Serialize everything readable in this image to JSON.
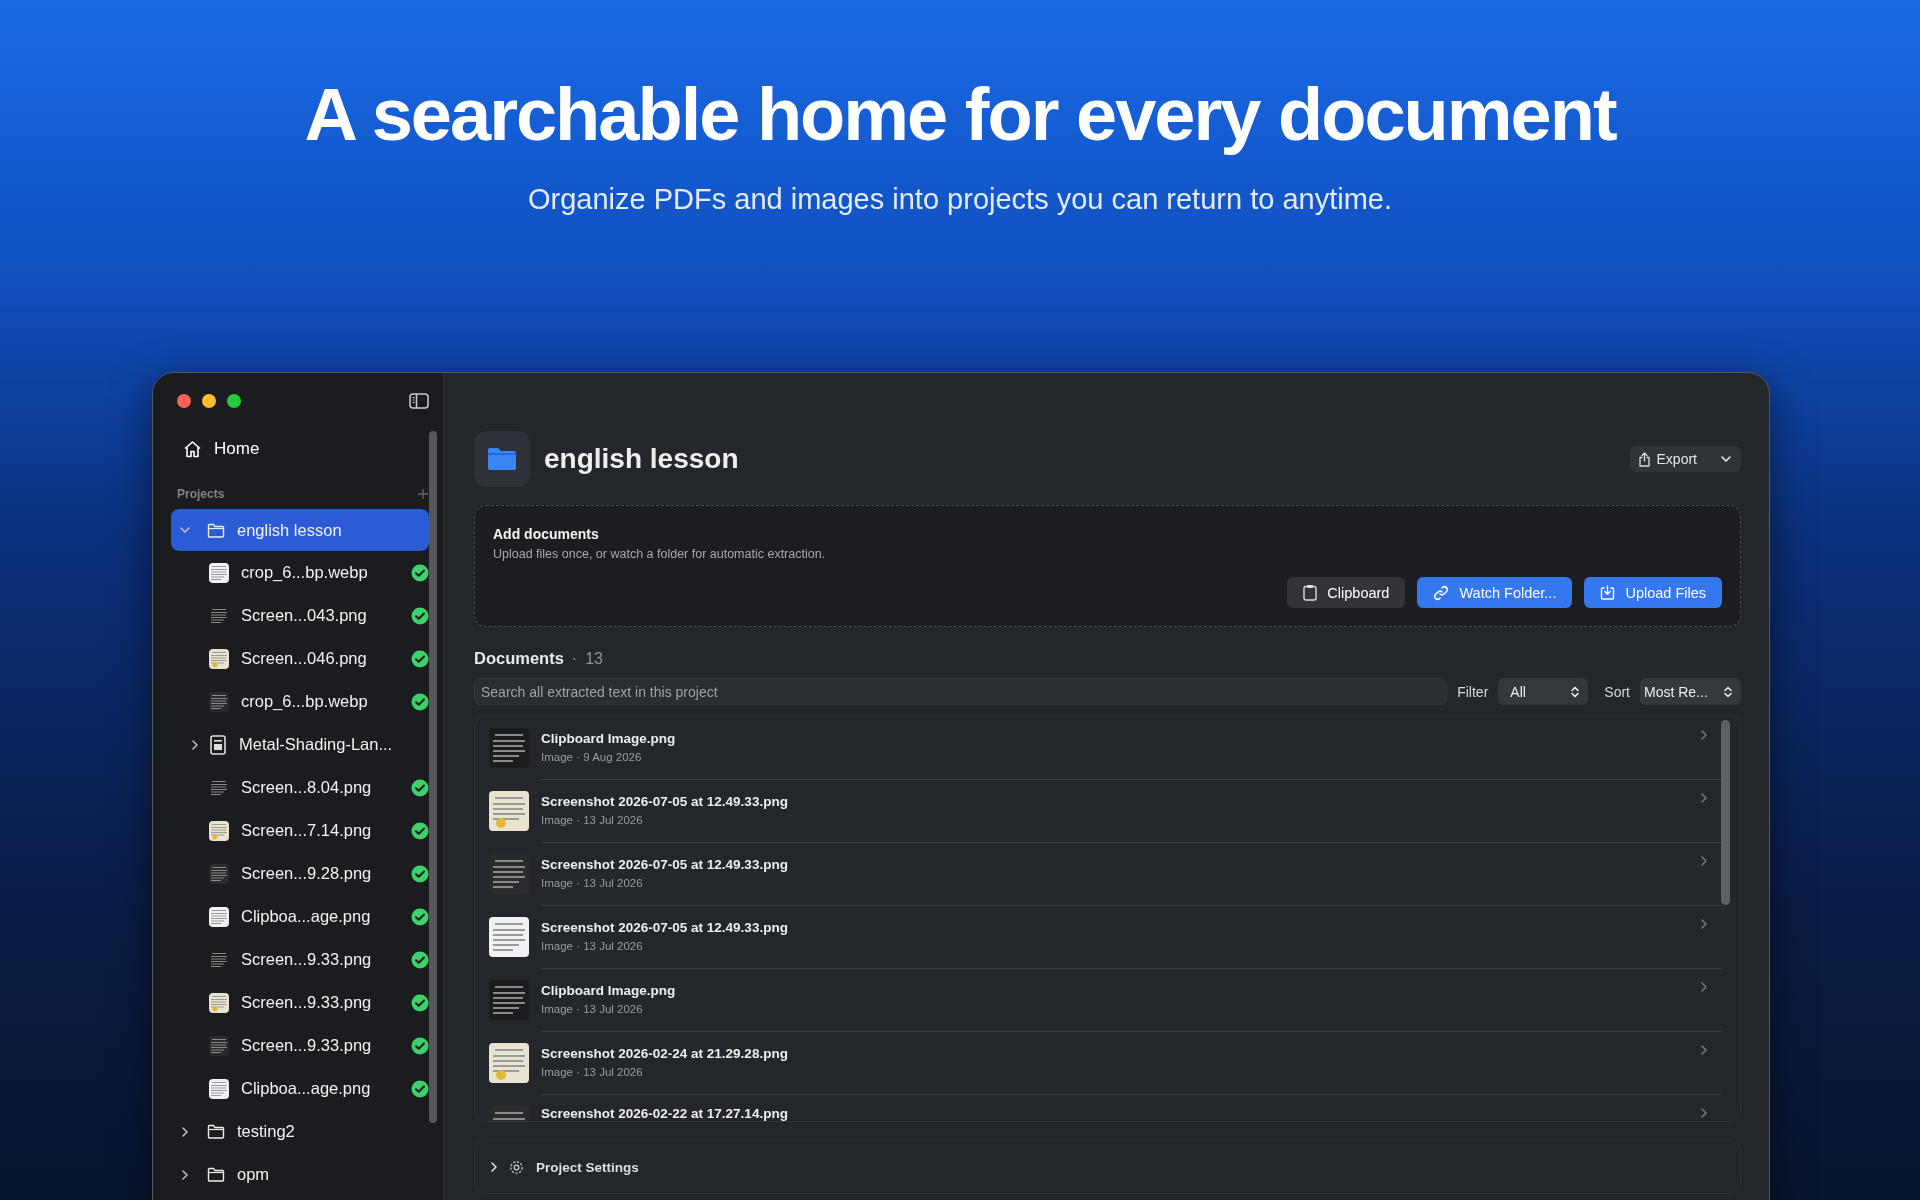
{
  "hero": {
    "title": "A searchable home for every document",
    "subtitle": "Organize PDFs and images into projects you can return to anytime."
  },
  "sidebar": {
    "home": "Home",
    "section": "Projects",
    "tree": [
      {
        "kind": "folder",
        "label": "english lesson",
        "selected": true,
        "expanded": true,
        "children": [
          {
            "label": "crop_6...bp.webp",
            "done": true
          },
          {
            "label": "Screen...043.png",
            "done": true
          },
          {
            "label": "Screen...046.png",
            "done": true
          },
          {
            "label": "crop_6...bp.webp",
            "done": true
          },
          {
            "kind": "document",
            "label": "Metal-Shading-Lan...",
            "expanded": false,
            "done": false
          },
          {
            "label": "Screen...8.04.png",
            "done": true
          },
          {
            "label": "Screen...7.14.png",
            "done": true
          },
          {
            "label": "Screen...9.28.png",
            "done": true
          },
          {
            "label": "Clipboa...age.png",
            "done": true
          },
          {
            "label": "Screen...9.33.png",
            "done": true
          },
          {
            "label": "Screen...9.33.png",
            "done": true
          },
          {
            "label": "Screen...9.33.png",
            "done": true
          },
          {
            "label": "Clipboa...age.png",
            "done": true
          }
        ]
      },
      {
        "kind": "folder",
        "label": "testing2",
        "selected": false,
        "expanded": false
      },
      {
        "kind": "folder",
        "label": "opm",
        "selected": false,
        "expanded": false
      }
    ]
  },
  "main": {
    "title": "english lesson",
    "export": "Export",
    "add": {
      "title": "Add documents",
      "text": "Upload files once, or watch a folder for automatic extraction.",
      "buttons": [
        {
          "kind": "clipboard",
          "label": "Clipboard",
          "primary": false
        },
        {
          "kind": "link",
          "label": "Watch Folder...",
          "primary": true
        },
        {
          "kind": "upload",
          "label": "Upload Files",
          "primary": true
        }
      ]
    },
    "documents": {
      "title": "Documents",
      "separator": "·",
      "count": "13",
      "search_placeholder": "Search all extracted text in this project",
      "filter_label": "Filter",
      "filter": "All",
      "sort_label": "Sort",
      "sort": "Most Re..."
    },
    "rows": [
      {
        "name": "Clipboard Image.png",
        "meta": "Image · 9 Aug 2026"
      },
      {
        "name": "Screenshot 2026-07-05 at 12.49.33.png",
        "meta": "Image · 13 Jul 2026"
      },
      {
        "name": "Screenshot 2026-07-05 at 12.49.33.png",
        "meta": "Image · 13 Jul 2026"
      },
      {
        "name": "Screenshot 2026-07-05 at 12.49.33.png",
        "meta": "Image · 13 Jul 2026"
      },
      {
        "name": "Clipboard Image.png",
        "meta": "Image · 13 Jul 2026"
      },
      {
        "name": "Screenshot 2026-02-24 at 21.29.28.png",
        "meta": "Image · 13 Jul 2026"
      },
      {
        "name": "Screenshot 2026-02-22 at 17.27.14.png"
      }
    ],
    "settings": "Project Settings"
  }
}
